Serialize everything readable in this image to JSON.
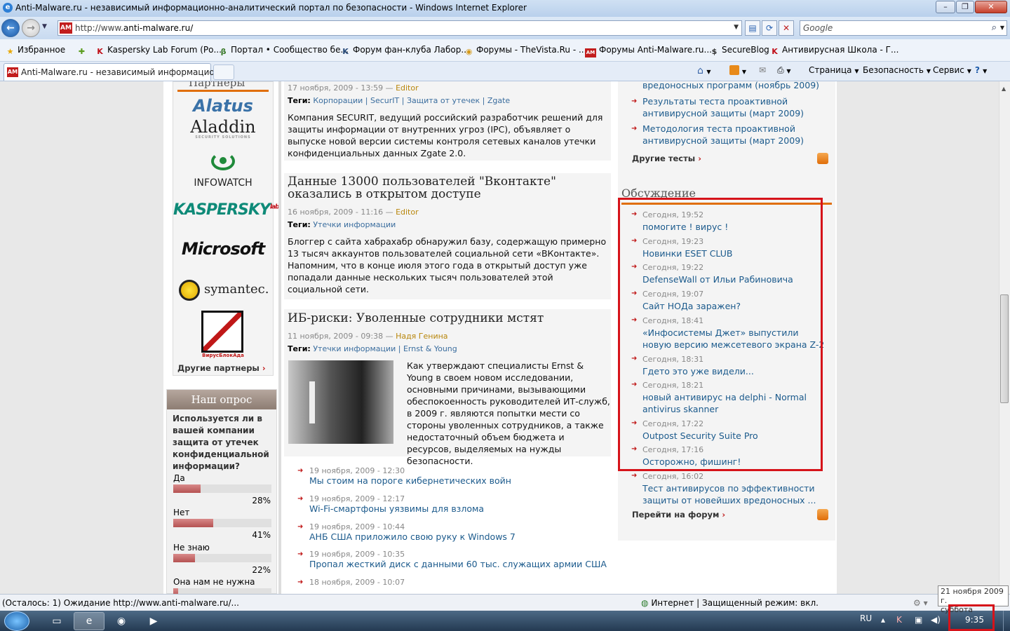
{
  "window": {
    "title": "Anti-Malware.ru - независимый информационно-аналитический портал по безопасности - Windows Internet Explorer"
  },
  "address": {
    "url_prefix": "http://www.",
    "url_domain": "anti-malware.ru/",
    "search_placeholder": "Google"
  },
  "favorites": {
    "items": [
      "Избранное",
      "Kaspersky Lab Forum (Ро...",
      "Портал • Сообщество бе...",
      "Форум фан-клуба Лабор...",
      "Форумы - TheVista.Ru - ...",
      "Форумы Anti-Malware.ru...",
      "SecureBlog",
      "Антивирусная Школа - Г..."
    ]
  },
  "tabs": {
    "active": "Anti-Malware.ru - независимый информацион..."
  },
  "commands": {
    "page": "Страница",
    "safety": "Безопасность",
    "tools": "Сервис"
  },
  "left": {
    "partners_title": "Партнеры",
    "logos": [
      "Alatus",
      "Aladdin",
      "INFOWATCH",
      "KASPERSKY",
      "Microsoft",
      "symantec.",
      "ВирусБлокАда"
    ],
    "aladdin_sub": "SECURITY SOLUTIONS",
    "lab": "lab",
    "other_partners": "Другие партнеры",
    "poll": {
      "title": "Наш опрос",
      "question": "Используется ли в вашей компании защита от утечек конфиденциальной информации?",
      "options": [
        {
          "label": "Да",
          "pct": "28%",
          "value": 28
        },
        {
          "label": "Нет",
          "pct": "41%",
          "value": 41
        },
        {
          "label": "Не знаю",
          "pct": "22%",
          "value": 22
        },
        {
          "label": "Она нам не нужна",
          "pct": "",
          "value": 5
        }
      ]
    }
  },
  "center": {
    "a1": {
      "meta_date": "17 ноября, 2009 - 13:59 —",
      "meta_author": "Editor",
      "tags_label": "Теги:",
      "tags": [
        "Корпорации",
        "SecurIT",
        "Защита от утечек",
        "Zgate"
      ],
      "body": "Компания  SECURIT, ведущий российский разработчик решений для защиты информации от внутренних угроз (IPC), объявляет о выпуске новой версии системы контроля сетевых каналов утечки конфиденциальных данных Zgate 2.0."
    },
    "a2": {
      "title": "Данные 13000 пользователей \"Вконтакте\" оказались в открытом доступе",
      "meta_date": "16 ноября, 2009 - 11:16 —",
      "meta_author": "Editor",
      "tags_label": "Теги:",
      "tags": [
        "Утечки информации"
      ],
      "body": "Блоггер с сайта хабрахабр обнаружил базу, содержащую примерно 13 тысяч аккаунтов пользователей социальной сети «ВКонтакте». Напомним, что в конце июля этого года в открытый доступ уже попадали данные нескольких тысяч пользователей этой социальной сети."
    },
    "a3": {
      "title": "ИБ-риски: Уволенные сотрудники мстят",
      "meta_date": "11 ноября, 2009 - 09:38 —",
      "meta_author": "Надя Генина",
      "tags_label": "Теги:",
      "tags": [
        "Утечки информации",
        "Ernst & Young"
      ],
      "body": "Как утверждают специалисты Ernst & Young в своем новом исследовании, основными причинами, вызывающими обеспокоенность руководителей ИТ-служб, в 2009 г. являются попытки мести со стороны уволенных сотрудников, а также недостаточный объем бюджета и ресурсов, выделяемых на нужды безопасности."
    },
    "news": [
      {
        "date": "19 ноября, 2009 - 12:30",
        "title": "Мы стоим на пороге кибернетических войн"
      },
      {
        "date": "19 ноября, 2009 - 12:17",
        "title": "Wi-Fi-смартфоны уязвимы для взлома"
      },
      {
        "date": "19 ноября, 2009 - 10:44",
        "title": "АНБ США приложило свою руку к Windows 7"
      },
      {
        "date": "19 ноября, 2009 - 10:35",
        "title": "Пропал жесткий диск с данными 60 тыс. служащих армии США"
      },
      {
        "date": "18 ноября, 2009 - 10:07",
        "title": ""
      }
    ]
  },
  "right": {
    "top_cut": "вредоносных программ (ноябрь 2009)",
    "tests": [
      "Результаты теста проактивной антивирусной защиты (март 2009)",
      "Методология теста проактивной антивирусной защиты (март 2009)"
    ],
    "other_tests": "Другие тесты",
    "discussion_title": "Обсуждение",
    "posts": [
      {
        "date": "Сегодня, 19:52",
        "title": "помогите ! вирус !"
      },
      {
        "date": "Сегодня, 19:23",
        "title": "Новинки ESET CLUB"
      },
      {
        "date": "Сегодня, 19:22",
        "title": "DefenseWall от Ильи Рабиновича"
      },
      {
        "date": "Сегодня, 19:07",
        "title": "Сайт НОДа заражен?"
      },
      {
        "date": "Сегодня, 18:41",
        "title": "«Инфосистемы Джет» выпустили новую версию межсетевого экрана Z-2"
      },
      {
        "date": "Сегодня, 18:31",
        "title": "Гдето это уже видели..."
      },
      {
        "date": "Сегодня, 18:21",
        "title": "новый антивирус на delphi - Normal antivirus skanner"
      },
      {
        "date": "Сегодня, 17:22",
        "title": "Outpost Security Suite Pro"
      },
      {
        "date": "Сегодня, 17:16",
        "title": "Осторожно, фишинг!"
      },
      {
        "date": "Сегодня, 16:02",
        "title": "Тест антивирусов по эффективности защиты от новейших вредоносных ..."
      }
    ],
    "forum_link": "Перейти на форум"
  },
  "status": {
    "left": "(Осталось: 1) Ожидание http://www.anti-malware.ru/...",
    "zone": "Интернет | Защищенный режим: вкл."
  },
  "taskbar": {
    "lang": "RU",
    "time": "9:35",
    "date_tip": "21 ноября 2009 г.",
    "day_tip": "суббота"
  },
  "colors": {
    "highlight": "#d6131a",
    "link": "#1b5a8c",
    "accent_orange": "#e06e0a"
  }
}
